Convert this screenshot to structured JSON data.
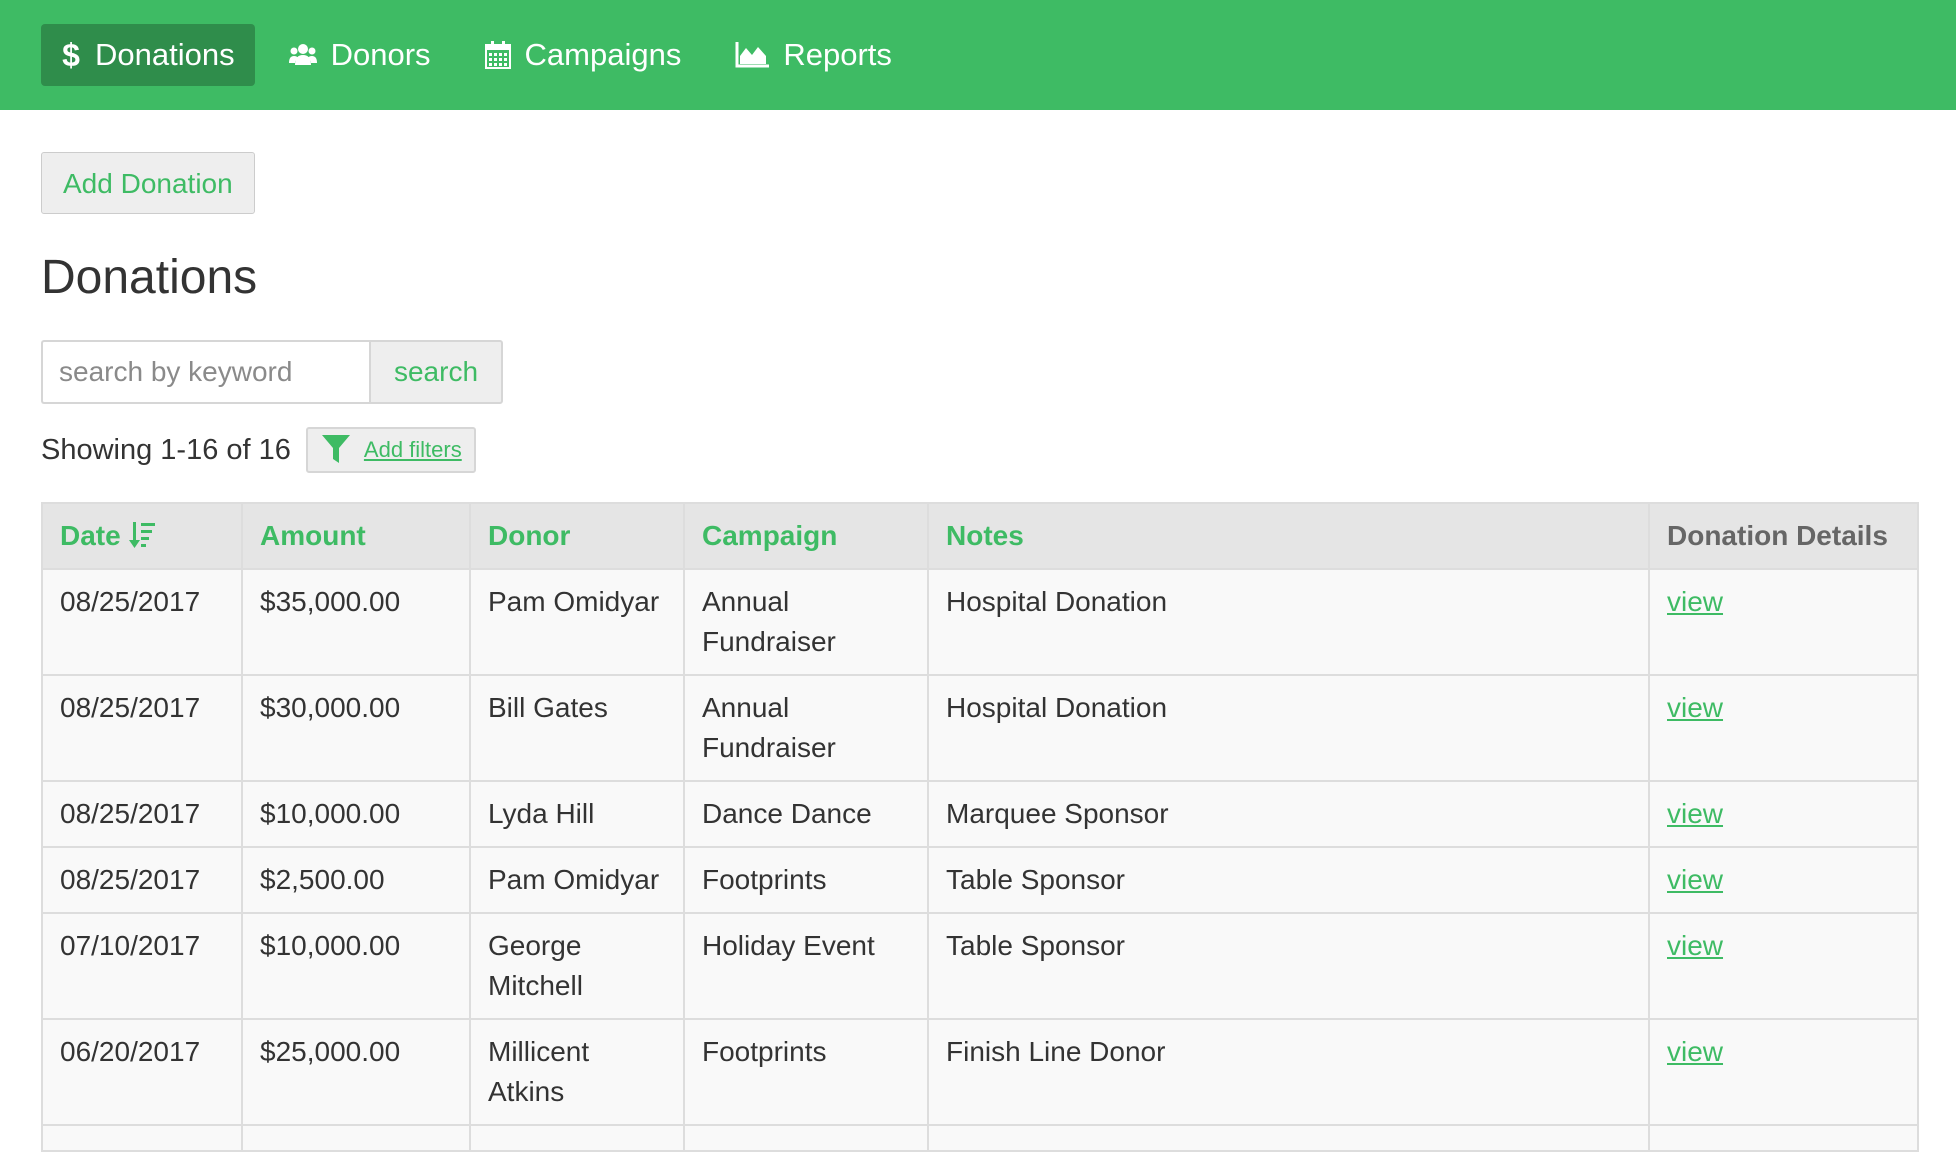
{
  "nav": {
    "items": [
      {
        "label": "Donations",
        "icon": "dollar-icon",
        "active": true
      },
      {
        "label": "Donors",
        "icon": "users-icon",
        "active": false
      },
      {
        "label": "Campaigns",
        "icon": "calendar-icon",
        "active": false
      },
      {
        "label": "Reports",
        "icon": "area-chart-icon",
        "active": false
      }
    ]
  },
  "toolbar": {
    "add_label": "Add Donation"
  },
  "page": {
    "title": "Donations"
  },
  "search": {
    "placeholder": "search by keyword",
    "value": "",
    "button_label": "search"
  },
  "results": {
    "showing": "Showing 1-16 of 16",
    "filter_label": "Add filters"
  },
  "table": {
    "columns": [
      "Date",
      "Amount",
      "Donor",
      "Campaign",
      "Notes",
      "Donation Details"
    ],
    "rows": [
      {
        "date": "08/25/2017",
        "amount": "$35,000.00",
        "donor": "Pam Omidyar",
        "campaign": "Annual Fundraiser",
        "notes": "Hospital Donation",
        "details": "view"
      },
      {
        "date": "08/25/2017",
        "amount": "$30,000.00",
        "donor": "Bill Gates",
        "campaign": "Annual Fundraiser",
        "notes": "Hospital Donation",
        "details": "view"
      },
      {
        "date": "08/25/2017",
        "amount": "$10,000.00",
        "donor": "Lyda Hill",
        "campaign": "Dance Dance",
        "notes": "Marquee Sponsor",
        "details": "view"
      },
      {
        "date": "08/25/2017",
        "amount": "$2,500.00",
        "donor": "Pam Omidyar",
        "campaign": "Footprints",
        "notes": "Table Sponsor",
        "details": "view"
      },
      {
        "date": "07/10/2017",
        "amount": "$10,000.00",
        "donor": "George Mitchell",
        "campaign": "Holiday Event",
        "notes": "Table Sponsor",
        "details": "view"
      },
      {
        "date": "06/20/2017",
        "amount": "$25,000.00",
        "donor": "Millicent Atkins",
        "campaign": "Footprints",
        "notes": "Finish Line Donor",
        "details": "view"
      },
      {
        "date": "",
        "amount": "",
        "donor": "",
        "campaign": "",
        "notes": "",
        "details": ""
      }
    ]
  },
  "colors": {
    "brand": "#3ebb64",
    "brand_dark": "#2f8d4b"
  }
}
